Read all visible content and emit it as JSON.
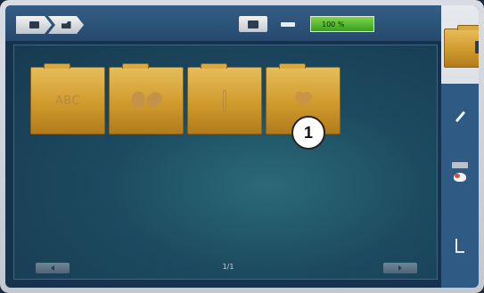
{
  "status_bar": {
    "zoom_label": "100 %"
  },
  "folders": [
    {
      "label": "ABC",
      "icon": "alphabet-icon"
    },
    {
      "label": "",
      "icon": "butterfly-icon"
    },
    {
      "label": "",
      "icon": "needle-icon"
    },
    {
      "label": "",
      "icon": "heart-icon"
    }
  ],
  "callout": {
    "text": "1"
  },
  "pagination": {
    "indicator": "1/1"
  },
  "sidebar": {
    "tabs": [
      "folder-icon",
      "pen-icon",
      "color-icon",
      "presser-foot-icon"
    ]
  },
  "colors": {
    "folder": "#d09a2c",
    "zoom": "#5dbb33",
    "panel": "#2e5a84"
  }
}
